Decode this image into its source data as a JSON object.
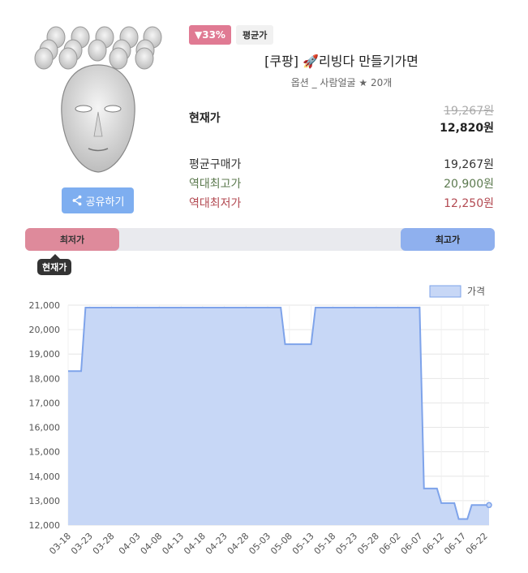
{
  "product": {
    "discount_badge": "▼33%",
    "avg_badge": "평균가",
    "title": "[쿠팡] 🚀리빙다 만들기가면",
    "option": "옵션 _ 사람얼굴 ★ 20개",
    "share_label": "공유하기"
  },
  "price": {
    "current_label": "현재가",
    "original": "19,267원",
    "current": "12,820원",
    "avg_label": "평균구매가",
    "avg": "19,267원",
    "high_label": "역대최고가",
    "high": "20,900원",
    "low_label": "역대최저가",
    "low": "12,250원"
  },
  "range": {
    "low_label": "최저가",
    "high_label": "최고가",
    "current_label": "현재가"
  },
  "colors": {
    "accent_low": "#de8a9b",
    "accent_high": "#8fb0ee",
    "line": "#7ea3ea",
    "fill": "#c7d7f6"
  },
  "chart_data": {
    "type": "area",
    "legend": "가격",
    "legend_position": "top-right",
    "ylim": [
      12000,
      21000
    ],
    "yticks": [
      "12,000",
      "13,000",
      "14,000",
      "15,000",
      "16,000",
      "17,000",
      "18,000",
      "19,000",
      "20,000",
      "21,000"
    ],
    "xticks": [
      "03-18",
      "03-23",
      "03-28",
      "04-03",
      "04-08",
      "04-13",
      "04-18",
      "04-23",
      "04-28",
      "05-03",
      "05-08",
      "05-13",
      "05-18",
      "05-23",
      "05-28",
      "06-02",
      "06-07",
      "06-12",
      "06-17",
      "06-22"
    ],
    "points": [
      {
        "x": "03-18",
        "y": 18300
      },
      {
        "x": "03-21",
        "y": 18300
      },
      {
        "x": "03-22",
        "y": 20900
      },
      {
        "x": "05-06",
        "y": 20900
      },
      {
        "x": "05-07",
        "y": 19400
      },
      {
        "x": "05-13",
        "y": 19400
      },
      {
        "x": "05-14",
        "y": 20900
      },
      {
        "x": "06-07",
        "y": 20900
      },
      {
        "x": "06-08",
        "y": 13500
      },
      {
        "x": "06-11",
        "y": 13500
      },
      {
        "x": "06-12",
        "y": 12900
      },
      {
        "x": "06-15",
        "y": 12900
      },
      {
        "x": "06-16",
        "y": 12250
      },
      {
        "x": "06-18",
        "y": 12250
      },
      {
        "x": "06-19",
        "y": 12820
      },
      {
        "x": "06-23",
        "y": 12820
      }
    ],
    "grid": true
  }
}
